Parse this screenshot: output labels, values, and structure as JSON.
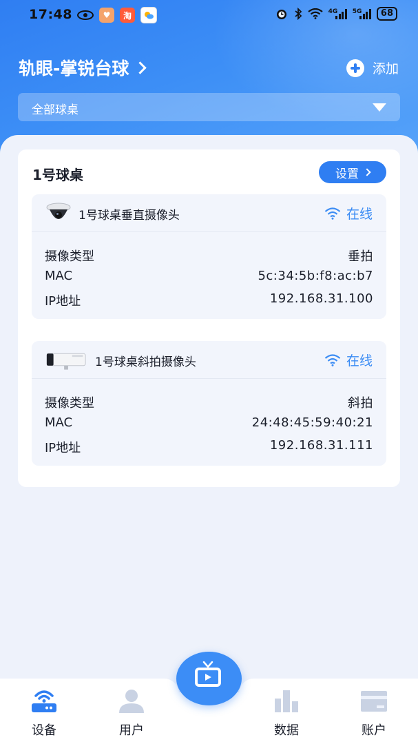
{
  "status_bar": {
    "time": "17:48",
    "signal_1_label": "4G",
    "signal_2_label": "5G",
    "battery": "68"
  },
  "header": {
    "venue_name": "轨眼-掌锐台球",
    "add_label": "添加",
    "filter_label": "全部球桌"
  },
  "table": {
    "title": "1号球桌",
    "settings_label": "设置",
    "cameras": [
      {
        "name": "1号球桌垂直摄像头",
        "status": "在线",
        "rows": [
          {
            "label": "摄像类型",
            "value": "垂拍"
          },
          {
            "label": "MAC",
            "value": "5c:34:5b:f8:ac:b7"
          },
          {
            "label": "IP地址",
            "value": "192.168.31.100"
          }
        ]
      },
      {
        "name": "1号球桌斜拍摄像头",
        "status": "在线",
        "rows": [
          {
            "label": "摄像类型",
            "value": "斜拍"
          },
          {
            "label": "MAC",
            "value": "24:48:45:59:40:21"
          },
          {
            "label": "IP地址",
            "value": "192.168.31.111"
          }
        ]
      }
    ]
  },
  "nav": {
    "items": [
      {
        "label": "设备",
        "icon": "router-icon",
        "active": true
      },
      {
        "label": "用户",
        "icon": "user-icon",
        "active": false
      },
      {
        "label": "数据",
        "icon": "bar-chart-icon",
        "active": false
      },
      {
        "label": "账户",
        "icon": "card-icon",
        "active": false
      }
    ],
    "center_icon": "tv-icon"
  },
  "colors": {
    "accent": "#2f7ef2",
    "online": "#3b8cf4",
    "inactive_icon": "#c9d2e3"
  }
}
